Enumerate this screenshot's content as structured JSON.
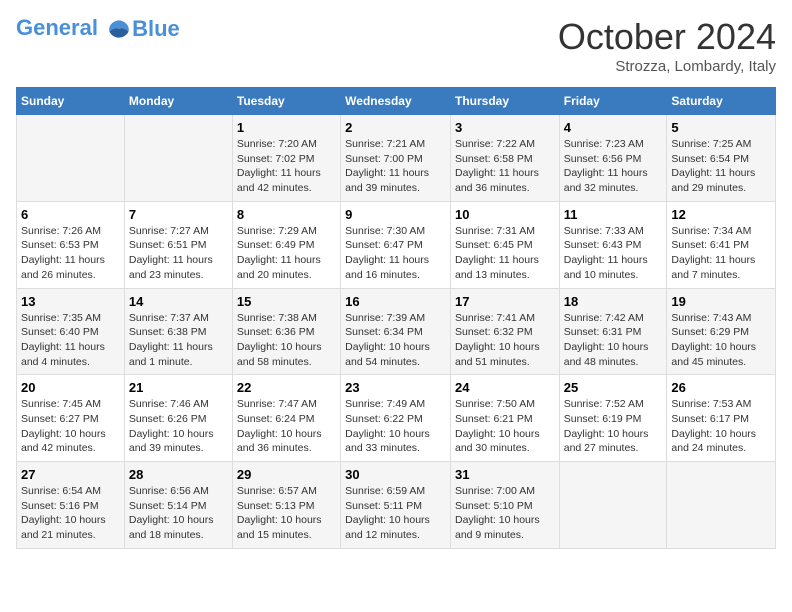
{
  "header": {
    "logo_line1": "General",
    "logo_line2": "Blue",
    "month": "October 2024",
    "location": "Strozza, Lombardy, Italy"
  },
  "weekdays": [
    "Sunday",
    "Monday",
    "Tuesday",
    "Wednesday",
    "Thursday",
    "Friday",
    "Saturday"
  ],
  "weeks": [
    [
      {
        "day": "",
        "content": ""
      },
      {
        "day": "",
        "content": ""
      },
      {
        "day": "1",
        "content": "Sunrise: 7:20 AM\nSunset: 7:02 PM\nDaylight: 11 hours and 42 minutes."
      },
      {
        "day": "2",
        "content": "Sunrise: 7:21 AM\nSunset: 7:00 PM\nDaylight: 11 hours and 39 minutes."
      },
      {
        "day": "3",
        "content": "Sunrise: 7:22 AM\nSunset: 6:58 PM\nDaylight: 11 hours and 36 minutes."
      },
      {
        "day": "4",
        "content": "Sunrise: 7:23 AM\nSunset: 6:56 PM\nDaylight: 11 hours and 32 minutes."
      },
      {
        "day": "5",
        "content": "Sunrise: 7:25 AM\nSunset: 6:54 PM\nDaylight: 11 hours and 29 minutes."
      }
    ],
    [
      {
        "day": "6",
        "content": "Sunrise: 7:26 AM\nSunset: 6:53 PM\nDaylight: 11 hours and 26 minutes."
      },
      {
        "day": "7",
        "content": "Sunrise: 7:27 AM\nSunset: 6:51 PM\nDaylight: 11 hours and 23 minutes."
      },
      {
        "day": "8",
        "content": "Sunrise: 7:29 AM\nSunset: 6:49 PM\nDaylight: 11 hours and 20 minutes."
      },
      {
        "day": "9",
        "content": "Sunrise: 7:30 AM\nSunset: 6:47 PM\nDaylight: 11 hours and 16 minutes."
      },
      {
        "day": "10",
        "content": "Sunrise: 7:31 AM\nSunset: 6:45 PM\nDaylight: 11 hours and 13 minutes."
      },
      {
        "day": "11",
        "content": "Sunrise: 7:33 AM\nSunset: 6:43 PM\nDaylight: 11 hours and 10 minutes."
      },
      {
        "day": "12",
        "content": "Sunrise: 7:34 AM\nSunset: 6:41 PM\nDaylight: 11 hours and 7 minutes."
      }
    ],
    [
      {
        "day": "13",
        "content": "Sunrise: 7:35 AM\nSunset: 6:40 PM\nDaylight: 11 hours and 4 minutes."
      },
      {
        "day": "14",
        "content": "Sunrise: 7:37 AM\nSunset: 6:38 PM\nDaylight: 11 hours and 1 minute."
      },
      {
        "day": "15",
        "content": "Sunrise: 7:38 AM\nSunset: 6:36 PM\nDaylight: 10 hours and 58 minutes."
      },
      {
        "day": "16",
        "content": "Sunrise: 7:39 AM\nSunset: 6:34 PM\nDaylight: 10 hours and 54 minutes."
      },
      {
        "day": "17",
        "content": "Sunrise: 7:41 AM\nSunset: 6:32 PM\nDaylight: 10 hours and 51 minutes."
      },
      {
        "day": "18",
        "content": "Sunrise: 7:42 AM\nSunset: 6:31 PM\nDaylight: 10 hours and 48 minutes."
      },
      {
        "day": "19",
        "content": "Sunrise: 7:43 AM\nSunset: 6:29 PM\nDaylight: 10 hours and 45 minutes."
      }
    ],
    [
      {
        "day": "20",
        "content": "Sunrise: 7:45 AM\nSunset: 6:27 PM\nDaylight: 10 hours and 42 minutes."
      },
      {
        "day": "21",
        "content": "Sunrise: 7:46 AM\nSunset: 6:26 PM\nDaylight: 10 hours and 39 minutes."
      },
      {
        "day": "22",
        "content": "Sunrise: 7:47 AM\nSunset: 6:24 PM\nDaylight: 10 hours and 36 minutes."
      },
      {
        "day": "23",
        "content": "Sunrise: 7:49 AM\nSunset: 6:22 PM\nDaylight: 10 hours and 33 minutes."
      },
      {
        "day": "24",
        "content": "Sunrise: 7:50 AM\nSunset: 6:21 PM\nDaylight: 10 hours and 30 minutes."
      },
      {
        "day": "25",
        "content": "Sunrise: 7:52 AM\nSunset: 6:19 PM\nDaylight: 10 hours and 27 minutes."
      },
      {
        "day": "26",
        "content": "Sunrise: 7:53 AM\nSunset: 6:17 PM\nDaylight: 10 hours and 24 minutes."
      }
    ],
    [
      {
        "day": "27",
        "content": "Sunrise: 6:54 AM\nSunset: 5:16 PM\nDaylight: 10 hours and 21 minutes."
      },
      {
        "day": "28",
        "content": "Sunrise: 6:56 AM\nSunset: 5:14 PM\nDaylight: 10 hours and 18 minutes."
      },
      {
        "day": "29",
        "content": "Sunrise: 6:57 AM\nSunset: 5:13 PM\nDaylight: 10 hours and 15 minutes."
      },
      {
        "day": "30",
        "content": "Sunrise: 6:59 AM\nSunset: 5:11 PM\nDaylight: 10 hours and 12 minutes."
      },
      {
        "day": "31",
        "content": "Sunrise: 7:00 AM\nSunset: 5:10 PM\nDaylight: 10 hours and 9 minutes."
      },
      {
        "day": "",
        "content": ""
      },
      {
        "day": "",
        "content": ""
      }
    ]
  ]
}
